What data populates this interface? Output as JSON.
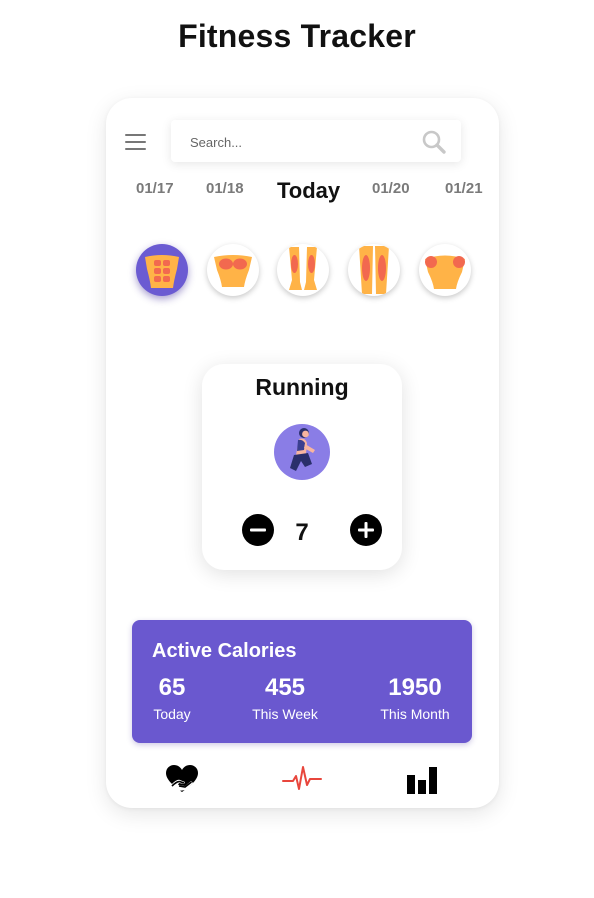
{
  "page": {
    "title": "Fitness Tracker"
  },
  "search": {
    "placeholder": "Search..."
  },
  "dates": [
    "01/17",
    "01/18",
    "Today",
    "01/20",
    "01/21"
  ],
  "muscle_groups": [
    {
      "icon": "abs-icon",
      "active": true
    },
    {
      "icon": "chest-icon",
      "active": false
    },
    {
      "icon": "calves-icon",
      "active": false
    },
    {
      "icon": "hamstrings-icon",
      "active": false
    },
    {
      "icon": "shoulders-icon",
      "active": false
    }
  ],
  "workout": {
    "name": "Running",
    "count": "7",
    "icon": "runner-icon"
  },
  "calories": {
    "title": "Active Calories",
    "stats": [
      {
        "value": "65",
        "label": "Today"
      },
      {
        "value": "455",
        "label": "This Week"
      },
      {
        "value": "1950",
        "label": "This Month"
      }
    ]
  },
  "bottom_nav": [
    "heart-hand-icon",
    "heartbeat-icon",
    "bar-chart-icon"
  ],
  "colors": {
    "accent": "#6a58cf",
    "muscle_base": "#ffb347",
    "muscle_highlight": "#f2694f",
    "heartbeat": "#e8463c"
  }
}
